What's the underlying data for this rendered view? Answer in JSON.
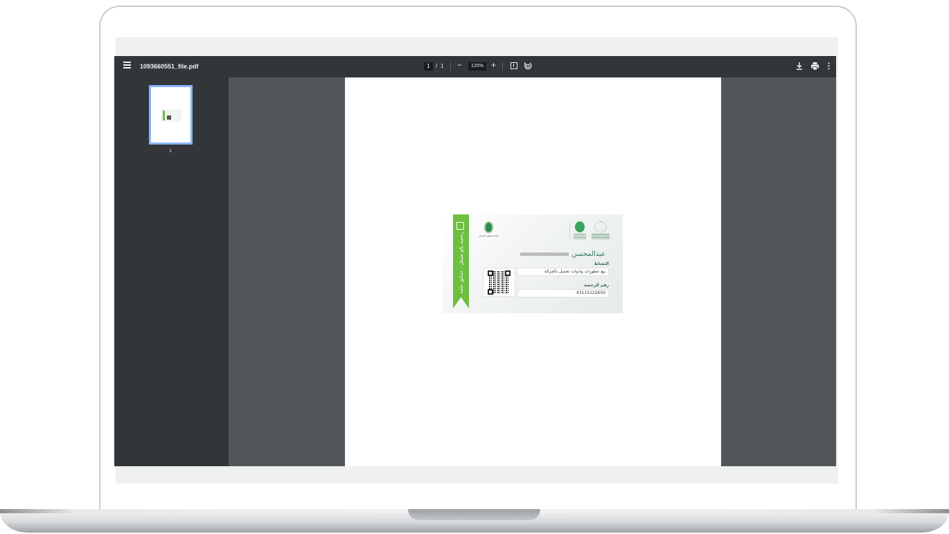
{
  "viewer": {
    "file_name": "1093660551_file.pdf",
    "current_page": "1",
    "page_separator": "/",
    "total_pages": "1",
    "zoom_minus": "−",
    "zoom_level": "125%",
    "zoom_plus": "+",
    "thumbnail_label": "1"
  },
  "icons": {
    "menu": "menu-icon",
    "fit": "fit-to-page-icon",
    "rotate": "rotate-icon",
    "download": "download-icon",
    "print": "print-icon",
    "more": "more-vert-icon"
  },
  "certificate": {
    "ribbon_text": "رخصة بائع متنقل - حدائق عامة",
    "left_logo_caption": "أمانة منطقة الرياض",
    "name": "عبدالمحسن",
    "activity_label": "النشاط",
    "activity_value": "بيع عطورات وادوات تجميل بالجزالة",
    "license_label": "رقم الرخصة",
    "license_value": "43115122650"
  },
  "colors": {
    "toolbar": "#323639",
    "viewer_bg": "#525659",
    "ribbon": "#6cbf3f",
    "thumb_border": "#8ab4f8",
    "name_green": "#2f7a56"
  }
}
